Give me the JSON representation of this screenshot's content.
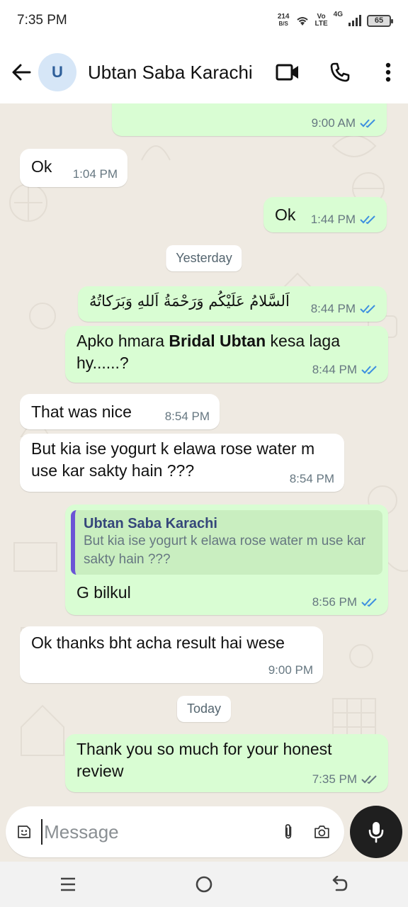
{
  "status_bar": {
    "time": "7:35 PM",
    "net_speed_value": "214",
    "net_speed_unit": "B/S",
    "volte_top": "Vo",
    "volte_bottom": "LTE",
    "network_type": "4G",
    "battery": "65"
  },
  "header": {
    "avatar_letter": "U",
    "contact_name": "Ubtan Saba Karachi",
    "icons": [
      "back-arrow-icon",
      "video-call-icon",
      "phone-icon",
      "more-options-icon"
    ]
  },
  "messages": [
    {
      "id": "m0",
      "direction": "outgoing",
      "text": "",
      "time": "9:00 AM",
      "status": "read"
    },
    {
      "id": "m1",
      "direction": "incoming",
      "text": "Ok",
      "time": "1:04 PM"
    },
    {
      "id": "m2",
      "direction": "outgoing",
      "text": "Ok",
      "time": "1:44 PM",
      "status": "read"
    },
    {
      "id": "m3",
      "direction": "outgoing",
      "text": "اَلسَّلامُ عَلَيْكُم وَرَحْمَةُ اَللهِ وَبَرَكاتُهُ",
      "time": "8:44 PM",
      "status": "read"
    },
    {
      "id": "m4",
      "direction": "outgoing",
      "text_before": "Apko hmara ",
      "text_bold": "Bridal Ubtan",
      "text_after": " kesa laga hy......?",
      "time": "8:44 PM",
      "status": "read"
    },
    {
      "id": "m5",
      "direction": "incoming",
      "text": "That was nice",
      "time": "8:54 PM"
    },
    {
      "id": "m6",
      "direction": "incoming",
      "text": "But kia ise yogurt k elawa rose water m use kar sakty hain ???",
      "time": "8:54 PM"
    },
    {
      "id": "m7",
      "direction": "outgoing",
      "quote_name": "Ubtan Saba Karachi",
      "quote_text": "But kia ise yogurt k elawa rose water m use kar sakty hain ???",
      "text": "G bilkul",
      "time": "8:56 PM",
      "status": "read"
    },
    {
      "id": "m8",
      "direction": "incoming",
      "text": "Ok thanks bht acha result hai wese",
      "time": "9:00 PM"
    },
    {
      "id": "m9",
      "direction": "outgoing",
      "text": "Thank you so much for your honest review",
      "time": "7:35 PM",
      "status": "delivered"
    }
  ],
  "date_separators": {
    "yesterday": "Yesterday",
    "today": "Today"
  },
  "colors": {
    "outgoing_bubble": "#d9fdd3",
    "incoming_bubble": "#ffffff",
    "read_tick": "#3d8fe0",
    "delivered_tick": "#667781",
    "chat_background": "#efeae2",
    "quote_bar": "#6b54d6"
  },
  "input": {
    "placeholder": "Message",
    "icons": [
      "sticker-icon",
      "attach-icon",
      "camera-icon",
      "mic-icon"
    ]
  },
  "nav_bar": {
    "icons": [
      "recent-apps-icon",
      "home-icon",
      "back-icon"
    ]
  }
}
